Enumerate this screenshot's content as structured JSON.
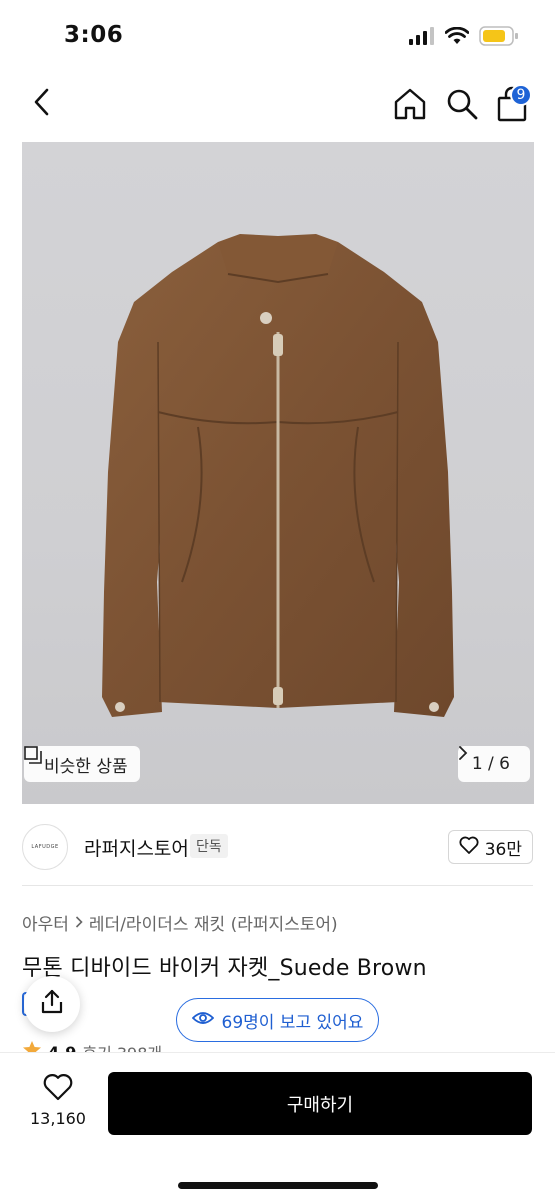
{
  "status_bar": {
    "time": "3:06",
    "icons": [
      "signal-icon",
      "wifi-icon",
      "battery-icon"
    ],
    "battery_color": "#f5c518"
  },
  "nav": {
    "icons": [
      "back-icon",
      "home-icon",
      "search-icon",
      "cart-icon"
    ],
    "cart_count": "9",
    "badge_color": "#1e63d6"
  },
  "gallery": {
    "similar_label": "비슷한 상품",
    "page_indicator": "1 / 6"
  },
  "store": {
    "logo_text": "LAFUDGE",
    "name": "라퍼지스토어",
    "tag": "단독",
    "likes": "36만"
  },
  "breadcrumb": {
    "category": "아우터",
    "subcategory": "레더/라이더스 재킷 (라퍼지스토어)"
  },
  "product": {
    "title": "무톤 디바이드 바이커 자켓_Suede Brown",
    "rating": "4.9",
    "review_label": "후기 398개"
  },
  "viewers": {
    "text": "69명이 보고 있어요",
    "accent_color": "#2a6de0"
  },
  "bottom_bar": {
    "wish_count": "13,160",
    "buy_label": "구매하기"
  }
}
